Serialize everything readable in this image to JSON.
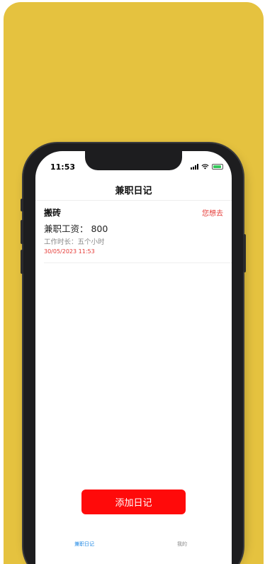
{
  "colors": {
    "background": "#e5c23f",
    "accent_red": "#ff0a0a",
    "tab_active": "#1e88e5"
  },
  "status_bar": {
    "time": "11:53",
    "icons": [
      "signal-icon",
      "wifi-icon",
      "battery-icon"
    ]
  },
  "nav": {
    "title": "兼职日记"
  },
  "entries": [
    {
      "title": "搬砖",
      "action": "您想去",
      "pay": "兼职工资：  800",
      "duration": "工作时长：五个小时",
      "date": "30/05/2023 11:53"
    }
  ],
  "add_button": {
    "label": "添加日记"
  },
  "tabs": [
    {
      "label": "兼职日记",
      "active": true
    },
    {
      "label": "我的",
      "active": false
    }
  ]
}
